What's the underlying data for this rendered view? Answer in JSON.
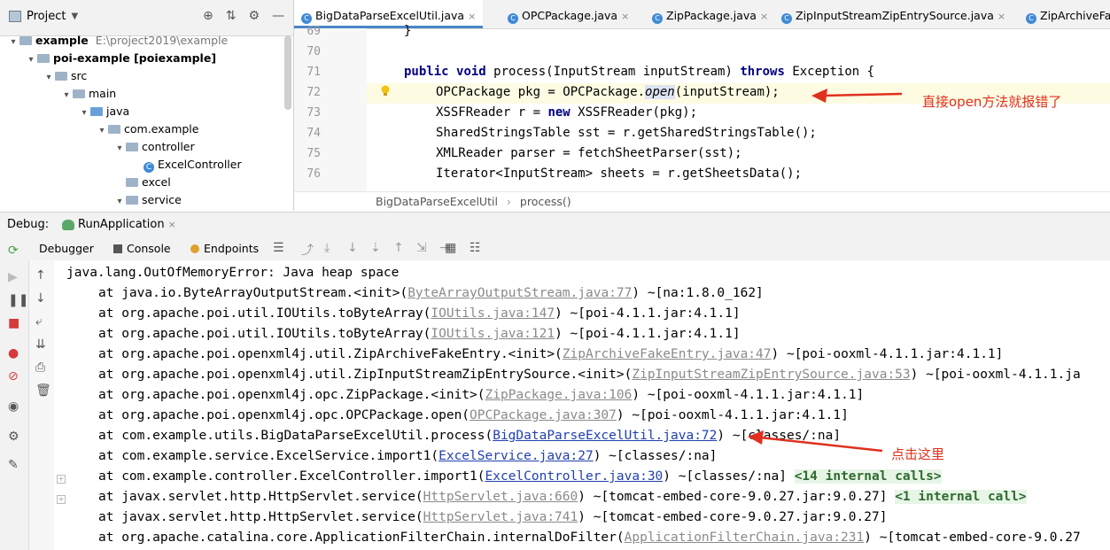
{
  "project": {
    "title": "Project",
    "tree": [
      {
        "indent": 0,
        "arrow": "▾",
        "icon": "folder",
        "label": "example",
        "extra": "E:\\project2019\\example",
        "bold": true
      },
      {
        "indent": 1,
        "arrow": "▾",
        "icon": "folder",
        "label": "poi-example [poiexample]",
        "extra": "",
        "bold": true
      },
      {
        "indent": 2,
        "arrow": "▾",
        "icon": "folder",
        "label": "src",
        "extra": "",
        "bold": false
      },
      {
        "indent": 3,
        "arrow": "▾",
        "icon": "folder",
        "label": "main",
        "extra": "",
        "bold": false
      },
      {
        "indent": 4,
        "arrow": "▾",
        "icon": "folder-blue",
        "label": "java",
        "extra": "",
        "bold": false
      },
      {
        "indent": 5,
        "arrow": "▾",
        "icon": "folder",
        "label": "com.example",
        "extra": "",
        "bold": false
      },
      {
        "indent": 6,
        "arrow": "▾",
        "icon": "folder",
        "label": "controller",
        "extra": "",
        "bold": false
      },
      {
        "indent": 7,
        "arrow": "",
        "icon": "class",
        "label": "ExcelController",
        "extra": "",
        "bold": false
      },
      {
        "indent": 6,
        "arrow": "",
        "icon": "folder",
        "label": "excel",
        "extra": "",
        "bold": false
      },
      {
        "indent": 6,
        "arrow": "▾",
        "icon": "folder",
        "label": "service",
        "extra": "",
        "bold": false
      }
    ]
  },
  "editor": {
    "tabs": [
      {
        "label": "BigDataParseExcelUtil.java",
        "active": true
      },
      {
        "label": "OPCPackage.java",
        "active": false
      },
      {
        "label": "ZipPackage.java",
        "active": false
      },
      {
        "label": "ZipInputStreamZipEntrySource.java",
        "active": false
      },
      {
        "label": "ZipArchiveFa",
        "active": false
      }
    ],
    "line_numbers": [
      "69",
      "70",
      "71",
      "72",
      "73",
      "74",
      "75",
      "76"
    ],
    "code": {
      "l69": "}",
      "l71_kw1": "public",
      "l71_kw2": "void",
      "l71_mid": " process(InputStream inputStream) ",
      "l71_kw3": "throws",
      "l71_end": " Exception {",
      "l72_a": "OPCPackage pkg = OPCPackage.",
      "l72_b": "open",
      "l72_c": "(inputStream);",
      "l73_a": "XSSFReader r = ",
      "l73_kw": "new",
      "l73_b": " XSSFReader(pkg);",
      "l74": "SharedStringsTable sst = r.getSharedStringsTable();",
      "l75": "XMLReader parser = fetchSheetParser(sst);",
      "l76": "Iterator<InputStream> sheets = r.getSheetsData();"
    },
    "breadcrumb": [
      "BigDataParseExcelUtil",
      "process()"
    ],
    "annotation": "直接open方法就报错了"
  },
  "debug": {
    "label": "Debug:",
    "run_config": "RunApplication",
    "tabs": [
      "Debugger",
      "Console",
      "Endpoints"
    ],
    "console": [
      {
        "pre": "java.lang.OutOfMemoryError: Java heap space",
        "link": "",
        "link_style": "",
        "post": "",
        "internal": "",
        "indent": false,
        "fold": false
      },
      {
        "pre": "at java.io.ByteArrayOutputStream.<init>(",
        "link": "ByteArrayOutputStream.java:77",
        "link_style": "grey",
        "post": ") ~[na:1.8.0_162]",
        "internal": "",
        "indent": true,
        "fold": false
      },
      {
        "pre": "at org.apache.poi.util.IOUtils.toByteArray(",
        "link": "IOUtils.java:147",
        "link_style": "grey",
        "post": ") ~[poi-4.1.1.jar:4.1.1]",
        "internal": "",
        "indent": true,
        "fold": false
      },
      {
        "pre": "at org.apache.poi.util.IOUtils.toByteArray(",
        "link": "IOUtils.java:121",
        "link_style": "grey",
        "post": ") ~[poi-4.1.1.jar:4.1.1]",
        "internal": "",
        "indent": true,
        "fold": false
      },
      {
        "pre": "at org.apache.poi.openxml4j.util.ZipArchiveFakeEntry.<init>(",
        "link": "ZipArchiveFakeEntry.java:47",
        "link_style": "grey",
        "post": ") ~[poi-ooxml-4.1.1.jar:4.1.1]",
        "internal": "",
        "indent": true,
        "fold": false
      },
      {
        "pre": "at org.apache.poi.openxml4j.util.ZipInputStreamZipEntrySource.<init>(",
        "link": "ZipInputStreamZipEntrySource.java:53",
        "link_style": "grey",
        "post": ") ~[poi-ooxml-4.1.1.ja",
        "internal": "",
        "indent": true,
        "fold": false
      },
      {
        "pre": "at org.apache.poi.openxml4j.opc.ZipPackage.<init>(",
        "link": "ZipPackage.java:106",
        "link_style": "grey",
        "post": ") ~[poi-ooxml-4.1.1.jar:4.1.1]",
        "internal": "",
        "indent": true,
        "fold": false
      },
      {
        "pre": "at org.apache.poi.openxml4j.opc.OPCPackage.open(",
        "link": "OPCPackage.java:307",
        "link_style": "grey",
        "post": ") ~[poi-ooxml-4.1.1.jar:4.1.1]",
        "internal": "",
        "indent": true,
        "fold": false
      },
      {
        "pre": "at com.example.utils.BigDataParseExcelUtil.process(",
        "link": "BigDataParseExcelUtil.java:72",
        "link_style": "blue",
        "post": ") ~[classes/:na]",
        "internal": "",
        "indent": true,
        "fold": false
      },
      {
        "pre": "at com.example.service.ExcelService.import1(",
        "link": "ExcelService.java:27",
        "link_style": "blue",
        "post": ") ~[classes/:na]",
        "internal": "",
        "indent": true,
        "fold": false
      },
      {
        "pre": "at com.example.controller.ExcelController.import1(",
        "link": "ExcelController.java:30",
        "link_style": "blue",
        "post": ") ~[classes/:na] ",
        "internal": "<14 internal calls>",
        "indent": true,
        "fold": true
      },
      {
        "pre": "at javax.servlet.http.HttpServlet.service(",
        "link": "HttpServlet.java:660",
        "link_style": "grey",
        "post": ") ~[tomcat-embed-core-9.0.27.jar:9.0.27] ",
        "internal": "<1 internal call>",
        "indent": true,
        "fold": true
      },
      {
        "pre": "at javax.servlet.http.HttpServlet.service(",
        "link": "HttpServlet.java:741",
        "link_style": "grey",
        "post": ") ~[tomcat-embed-core-9.0.27.jar:9.0.27]",
        "internal": "",
        "indent": true,
        "fold": false
      },
      {
        "pre": "at org.apache.catalina.core.ApplicationFilterChain.internalDoFilter(",
        "link": "ApplicationFilterChain.java:231",
        "link_style": "grey",
        "post": ") ~[tomcat-embed-core-9.0.27",
        "internal": "",
        "indent": true,
        "fold": false
      }
    ],
    "annotation": "点击这里"
  },
  "colors": {
    "annotation_red": "#e0301e",
    "link_blue": "#2140b0",
    "internal_bg": "#e7f5e7"
  }
}
